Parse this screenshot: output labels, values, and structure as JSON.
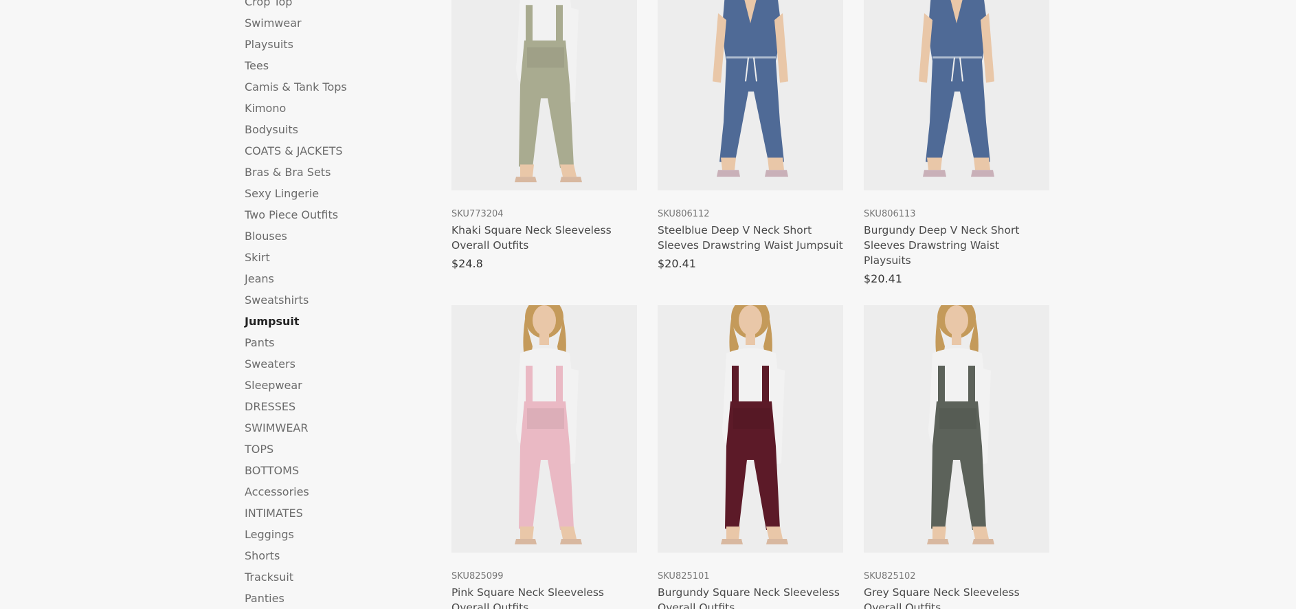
{
  "sidebar": {
    "items": [
      {
        "label": "Crop Top",
        "active": false
      },
      {
        "label": "Swimwear",
        "active": false
      },
      {
        "label": "Playsuits",
        "active": false
      },
      {
        "label": "Tees",
        "active": false
      },
      {
        "label": "Camis & Tank Tops",
        "active": false
      },
      {
        "label": "Kimono",
        "active": false
      },
      {
        "label": "Bodysuits",
        "active": false
      },
      {
        "label": "COATS & JACKETS",
        "active": false
      },
      {
        "label": "Bras & Bra Sets",
        "active": false
      },
      {
        "label": "Sexy Lingerie",
        "active": false
      },
      {
        "label": "Two Piece Outfits",
        "active": false
      },
      {
        "label": "Blouses",
        "active": false
      },
      {
        "label": "Skirt",
        "active": false
      },
      {
        "label": "Jeans",
        "active": false
      },
      {
        "label": "Sweatshirts",
        "active": false
      },
      {
        "label": "Jumpsuit",
        "active": true
      },
      {
        "label": "Pants",
        "active": false
      },
      {
        "label": "Sweaters",
        "active": false
      },
      {
        "label": "Sleepwear",
        "active": false
      },
      {
        "label": "DRESSES",
        "active": false
      },
      {
        "label": "SWIMWEAR",
        "active": false
      },
      {
        "label": "TOPS",
        "active": false
      },
      {
        "label": "BOTTOMS",
        "active": false
      },
      {
        "label": "Accessories",
        "active": false
      },
      {
        "label": "INTIMATES",
        "active": false
      },
      {
        "label": "Leggings",
        "active": false
      },
      {
        "label": "Shorts",
        "active": false
      },
      {
        "label": "Tracksuit",
        "active": false
      },
      {
        "label": "Panties",
        "active": false
      }
    ]
  },
  "products": [
    {
      "sku": "SKU773204",
      "name": "Khaki Square Neck Sleeveless Overall Outfits",
      "price": "$24.8",
      "color": "#a9ab90",
      "style": "overall"
    },
    {
      "sku": "SKU806112",
      "name": "Steelblue Deep V Neck Short Sleeves Drawstring Waist Jumpsuit",
      "price": "$20.41",
      "color": "#4f6a96",
      "style": "jumpsuit"
    },
    {
      "sku": "SKU806113",
      "name": "Burgundy Deep V Neck Short Sleeves Drawstring Waist Playsuits",
      "price": "$20.41",
      "color": "#4f6a96",
      "style": "jumpsuit"
    },
    {
      "sku": "SKU825099",
      "name": "Pink Square Neck Sleeveless Overall Outfits",
      "price": "",
      "color": "#eab9c4",
      "style": "overall"
    },
    {
      "sku": "SKU825101",
      "name": "Burgundy Square Neck Sleeveless Overall Outfits",
      "price": "",
      "color": "#5c1a28",
      "style": "overall"
    },
    {
      "sku": "SKU825102",
      "name": "Grey Square Neck Sleeveless Overall Outfits",
      "price": "",
      "color": "#5c625a",
      "style": "overall"
    }
  ]
}
